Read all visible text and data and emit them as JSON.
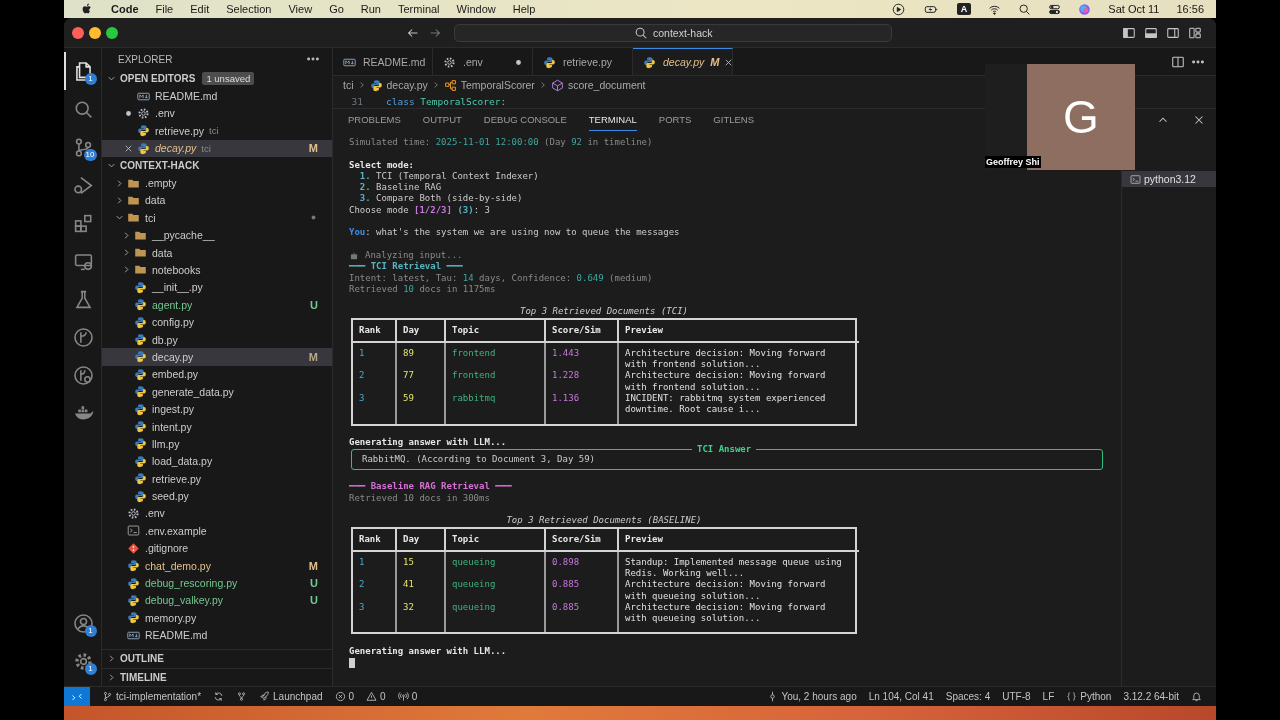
{
  "menu_bar": {
    "app": "Code",
    "items": [
      "File",
      "Edit",
      "Selection",
      "View",
      "Go",
      "Run",
      "Terminal",
      "Window",
      "Help"
    ],
    "input_source": "A",
    "date": "Sat Oct 11",
    "time": "16:56"
  },
  "title_bar": {
    "search": "context-hack"
  },
  "activity_bar": [
    {
      "kind": "files",
      "selected": true,
      "badge": "1"
    },
    {
      "kind": "search",
      "selected": false
    },
    {
      "kind": "scm",
      "selected": false,
      "badge": "10"
    },
    {
      "kind": "debug",
      "selected": false
    },
    {
      "kind": "extensions",
      "selected": false
    },
    {
      "kind": "remote",
      "selected": false
    },
    {
      "kind": "flask",
      "selected": false
    },
    {
      "kind": "gitlens",
      "selected": false
    },
    {
      "kind": "gitgraph",
      "selected": false
    },
    {
      "kind": "docker",
      "selected": false
    }
  ],
  "activity_bar_bottom": [
    {
      "kind": "account",
      "badge": "1"
    },
    {
      "kind": "gear",
      "badge": "1"
    }
  ],
  "explorer": {
    "title": "EXPLORER",
    "open_editors": {
      "title": "OPEN EDITORS",
      "badge": "1 unsaved",
      "expanded": true,
      "items": [
        {
          "name": "README.md",
          "kind": "markdown",
          "selected": false,
          "dirty": false,
          "preview": false
        },
        {
          "name": ".env",
          "kind": "gear",
          "selected": false,
          "dirty": true,
          "preview": false
        },
        {
          "name": "retrieve.py",
          "kind": "python",
          "folder": "tci",
          "selected": false,
          "dirty": false,
          "preview": false
        },
        {
          "name": "decay.py",
          "kind": "python",
          "folder": "tci",
          "selected": true,
          "dirty": false,
          "preview": true,
          "color": "#e2c08d",
          "badge": "M"
        }
      ]
    },
    "folder": {
      "title": "CONTEXT-HACK",
      "expanded": true,
      "items": [
        {
          "name": ".empty",
          "kind": "folder",
          "expanded": false,
          "selected": false
        },
        {
          "name": "data",
          "kind": "folder",
          "expanded": false,
          "selected": false
        },
        {
          "name": "tci",
          "kind": "folder",
          "expanded": true,
          "selected": false,
          "dot": true,
          "children": [
            {
              "name": "__pycache__",
              "kind": "folder",
              "expanded": false,
              "selected": false
            },
            {
              "name": "data",
              "kind": "folder",
              "expanded": false,
              "selected": false
            },
            {
              "name": "notebooks",
              "kind": "folder",
              "expanded": false,
              "selected": false
            },
            {
              "name": "__init__.py",
              "kind": "python",
              "selected": false
            },
            {
              "name": "agent.py",
              "kind": "python",
              "selected": false,
              "color": "#73c991",
              "badge": "U"
            },
            {
              "name": "config.py",
              "kind": "python",
              "selected": false
            },
            {
              "name": "db.py",
              "kind": "python",
              "selected": false
            },
            {
              "name": "decay.py",
              "kind": "python",
              "selected": true,
              "badge": "M"
            },
            {
              "name": "embed.py",
              "kind": "python",
              "selected": false
            },
            {
              "name": "generate_data.py",
              "kind": "python",
              "selected": false
            },
            {
              "name": "ingest.py",
              "kind": "python",
              "selected": false
            },
            {
              "name": "intent.py",
              "kind": "python",
              "selected": false
            },
            {
              "name": "llm.py",
              "kind": "python",
              "selected": false
            },
            {
              "name": "load_data.py",
              "kind": "python",
              "selected": false
            },
            {
              "name": "retrieve.py",
              "kind": "python",
              "selected": false
            },
            {
              "name": "seed.py",
              "kind": "python",
              "selected": false
            }
          ]
        },
        {
          "name": ".env",
          "kind": "gear",
          "selected": false
        },
        {
          "name": ".env.example",
          "kind": "terminal",
          "selected": false
        },
        {
          "name": ".gitignore",
          "kind": "gitfile",
          "selected": false
        },
        {
          "name": "chat_demo.py",
          "kind": "python",
          "selected": false,
          "color": "#e2c08d",
          "badge": "M"
        },
        {
          "name": "debug_rescoring.py",
          "kind": "python",
          "selected": false,
          "color": "#73c991",
          "badge": "U"
        },
        {
          "name": "debug_valkey.py",
          "kind": "python",
          "selected": false,
          "color": "#73c991",
          "badge": "U"
        },
        {
          "name": "memory.py",
          "kind": "python",
          "selected": false
        },
        {
          "name": "README.md",
          "kind": "markdown",
          "selected": false
        }
      ]
    },
    "outline": {
      "title": "OUTLINE",
      "expanded": false
    },
    "timeline": {
      "title": "TIMELINE",
      "expanded": false
    }
  },
  "editor": {
    "tabs": [
      {
        "label": "README.md",
        "kind": "markdown",
        "selected": false,
        "dirty": false,
        "preview": false
      },
      {
        "label": ".env",
        "kind": "gear",
        "selected": false,
        "dirty": true,
        "preview": false
      },
      {
        "label": "retrieve.py",
        "kind": "python",
        "selected": false,
        "dirty": false,
        "preview": false
      },
      {
        "label": "decay.py",
        "kind": "python",
        "selected": true,
        "dirty": false,
        "preview": true,
        "color": "#e2c08d",
        "badge": "M"
      }
    ],
    "breadcrumb": [
      {
        "text": "tci"
      },
      {
        "text": "decay.py",
        "kind": "python"
      },
      {
        "text": "TemporalScorer",
        "kind": "cls"
      },
      {
        "text": "score_document",
        "kind": "method"
      }
    ],
    "code": [
      {
        "number": "31",
        "tokens": [
          {
            "text": "class",
            "kind": "keyword"
          },
          {
            "text": "TemporalScorer:",
            "kind": "type"
          }
        ]
      }
    ]
  },
  "video_tile": {
    "initial": "G",
    "name": "Geoffrey Shi"
  },
  "panel": {
    "tabs": [
      {
        "label": "PROBLEMS",
        "selected": false
      },
      {
        "label": "OUTPUT",
        "selected": false
      },
      {
        "label": "DEBUG CONSOLE",
        "selected": false
      },
      {
        "label": "TERMINAL",
        "selected": true
      },
      {
        "label": "PORTS",
        "selected": false
      },
      {
        "label": "GITLENS",
        "selected": false
      }
    ],
    "terminals": [
      {
        "label": "python3.12",
        "selected": true
      }
    ],
    "lines": [
      {
        "kind": "text",
        "segments": [
          {
            "text": "Simulated time: ",
            "kind": "dim"
          },
          {
            "text": "2025-11-01 12:00:00",
            "kind": "value"
          },
          {
            "text": " (Day ",
            "kind": "dim"
          },
          {
            "text": "92",
            "kind": "value"
          },
          {
            "text": " in timeline)",
            "kind": "dim"
          }
        ]
      },
      {
        "kind": "blank"
      },
      {
        "kind": "text",
        "segments": [
          {
            "text": "Select mode:",
            "kind": "strong"
          }
        ]
      },
      {
        "kind": "text",
        "segments": [
          {
            "text": "  1.",
            "kind": "option"
          },
          {
            "text": " TCI (Temporal Context Indexer)",
            "kind": "plain"
          }
        ]
      },
      {
        "kind": "text",
        "segments": [
          {
            "text": "  2.",
            "kind": "option"
          },
          {
            "text": " Baseline RAG",
            "kind": "plain"
          }
        ]
      },
      {
        "kind": "text",
        "segments": [
          {
            "text": "  3.",
            "kind": "option"
          },
          {
            "text": " Compare Both (side-by-side)",
            "kind": "plain"
          }
        ]
      },
      {
        "kind": "text",
        "segments": [
          {
            "text": "Choose mode ",
            "kind": "plain"
          },
          {
            "text": "[1/2/3]",
            "kind": "choice"
          },
          {
            "text": " (3)",
            "kind": "option"
          },
          {
            "text": ": 3",
            "kind": "plain"
          }
        ]
      },
      {
        "kind": "blank"
      },
      {
        "kind": "text",
        "segments": [
          {
            "text": "You",
            "kind": "user"
          },
          {
            "text": ": what's the system we are using now to queue the messages",
            "kind": "plain"
          }
        ]
      },
      {
        "kind": "blank"
      },
      {
        "kind": "status",
        "segments": [
          {
            "text": "Analyzing input...",
            "kind": "dim"
          }
        ]
      },
      {
        "kind": "text",
        "segments": [
          {
            "text": "━━━ TCI Retrieval ━━━",
            "kind": "heading"
          }
        ]
      },
      {
        "kind": "text",
        "segments": [
          {
            "text": "Intent: latest, Tau: ",
            "kind": "dim"
          },
          {
            "text": "14",
            "kind": "value"
          },
          {
            "text": " days, Confidence: ",
            "kind": "dim"
          },
          {
            "text": "0.649",
            "kind": "value"
          },
          {
            "text": " (medium)",
            "kind": "dim"
          }
        ]
      },
      {
        "kind": "text",
        "segments": [
          {
            "text": "Retrieved ",
            "kind": "dim"
          },
          {
            "text": "10",
            "kind": "value"
          },
          {
            "text": " docs in 1175ms",
            "kind": "dim"
          }
        ]
      },
      {
        "kind": "blank"
      },
      {
        "kind": "table",
        "title": "Top 3 Retrieved Documents (TCI)",
        "columns": [
          "Rank",
          "Day",
          "Topic",
          "Score/Sim",
          "Preview"
        ],
        "rows": [
          [
            "1",
            "89",
            "frontend",
            "1.443",
            "Architecture decision: Moving forward\nwith frontend solution..."
          ],
          [
            "2",
            "77",
            "frontend",
            "1.228",
            "Architecture decision: Moving forward\nwith frontend solution..."
          ],
          [
            "3",
            "59",
            "rabbitmq",
            "1.136",
            "INCIDENT: rabbitmq system experienced\ndowntime. Root cause i..."
          ]
        ]
      },
      {
        "kind": "blank"
      },
      {
        "kind": "text",
        "segments": [
          {
            "text": "Generating answer with LLM...",
            "kind": "strong"
          }
        ]
      },
      {
        "kind": "answer",
        "title": "TCI Answer",
        "text": "RabbitMQ. (According to Document 3, Day 59)"
      },
      {
        "kind": "blank"
      },
      {
        "kind": "text",
        "segments": [
          {
            "text": "━━━ Baseline RAG Retrieval ━━━",
            "kind": "heading2"
          }
        ]
      },
      {
        "kind": "text",
        "segments": [
          {
            "text": "Retrieved 10 docs in 300ms",
            "kind": "dim"
          }
        ]
      },
      {
        "kind": "blank"
      },
      {
        "kind": "table",
        "title": "Top 3 Retrieved Documents (BASELINE)",
        "columns": [
          "Rank",
          "Day",
          "Topic",
          "Score/Sim",
          "Preview"
        ],
        "rows": [
          [
            "1",
            "15",
            "queueing",
            "0.898",
            "Standup: Implemented message queue using\nRedis. Working well..."
          ],
          [
            "2",
            "41",
            "queueing",
            "0.885",
            "Architecture decision: Moving forward\nwith queueing solution..."
          ],
          [
            "3",
            "32",
            "queueing",
            "0.885",
            "Architecture decision: Moving forward\nwith queueing solution..."
          ]
        ]
      },
      {
        "kind": "blank"
      },
      {
        "kind": "text",
        "segments": [
          {
            "text": "Generating answer with LLM...",
            "kind": "strong"
          }
        ]
      },
      {
        "kind": "cursor"
      }
    ]
  },
  "status_bar": {
    "left": [
      {
        "kind": "remoteStatus"
      },
      {
        "kind": "branch",
        "text": "tci-implementation*"
      },
      {
        "kind": "sync"
      },
      {
        "kind": "gitlensSmall"
      },
      {
        "kind": "rocket",
        "text": "Launchpad"
      },
      {
        "kind": "error",
        "text": "0"
      },
      {
        "kind": "warning",
        "text": "0"
      },
      {
        "kind": "broadcast",
        "text": "0"
      }
    ],
    "right": [
      {
        "kind": "commit",
        "text": "You, 2 hours ago"
      },
      {
        "text": "Ln 104, Col 41"
      },
      {
        "text": "Spaces: 4"
      },
      {
        "text": "UTF-8"
      },
      {
        "text": "LF"
      },
      {
        "kind": "braces",
        "text": "Python"
      },
      {
        "text": "3.12.2 64-bit"
      },
      {
        "kind": "bell"
      }
    ]
  }
}
